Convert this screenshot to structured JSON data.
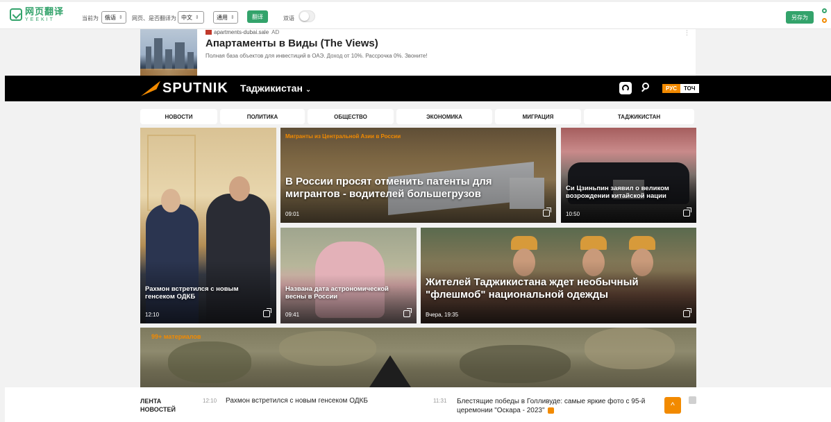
{
  "toolbar": {
    "logo_cn": "网页翻译",
    "logo_en": "YEEKIT",
    "current_label": "当前为",
    "current_value": "俄语",
    "translate_to_label": "网页、是否翻译为",
    "target_value": "中文",
    "engine_value": "通用",
    "translate_button": "翻译",
    "bilingual_label": "双语",
    "save_as_button": "另存为",
    "colors": {
      "accent": "#33a36b"
    }
  },
  "ad": {
    "source": "apartments-dubai.sale",
    "ad_tag": "AD",
    "title": "Апартаменты в Виды (The Views)",
    "description": "Полная база объектов для инвестиций в ОАЭ. Доход от 10%. Рассрочка 0%. Звоните!",
    "menu": "⋮"
  },
  "header": {
    "logo": "SPUTNIK",
    "region": "Таджикистан",
    "chevron": "⌄",
    "lang_active": "РУС",
    "lang_other": "ТОЧ",
    "colors": {
      "brand": "#f28a00"
    }
  },
  "nav": {
    "tabs": [
      "Новости",
      "Политика",
      "Общество",
      "Экономика",
      "Миграция",
      "Таджикистан"
    ]
  },
  "cards": [
    {
      "title": "Рахмон встретился с новым генсеком ОДКБ",
      "time": "12:10"
    },
    {
      "tag": "Мигранты из Центральной Азии в России",
      "title": "В России просят отменить патенты для мигрантов - водителей большегрузов",
      "time": "09:01"
    },
    {
      "title": "Си Цзиньпин заявил о великом возрождении китайской нации",
      "time": "10:50"
    },
    {
      "title": "Названа дата астрономической весны в России",
      "time": "09:41"
    },
    {
      "title": "Жителей Таджикистана ждет необычный \"флешмоб\" национальной одежды",
      "time": "Вчера, 19:35"
    },
    {
      "tag": "99+ материалов"
    }
  ],
  "feed": {
    "heading": "ЛЕНТА НОВОСТЕЙ",
    "items": [
      {
        "time": "12:10",
        "text": "Рахмон встретился с новым генсеком ОДКБ"
      },
      {
        "time": "11:31",
        "text": "Блестящие победы в Голливуде: самые яркие фото с 95-й церемонии \"Оскара - 2023\""
      }
    ],
    "up_arrow": "^"
  }
}
